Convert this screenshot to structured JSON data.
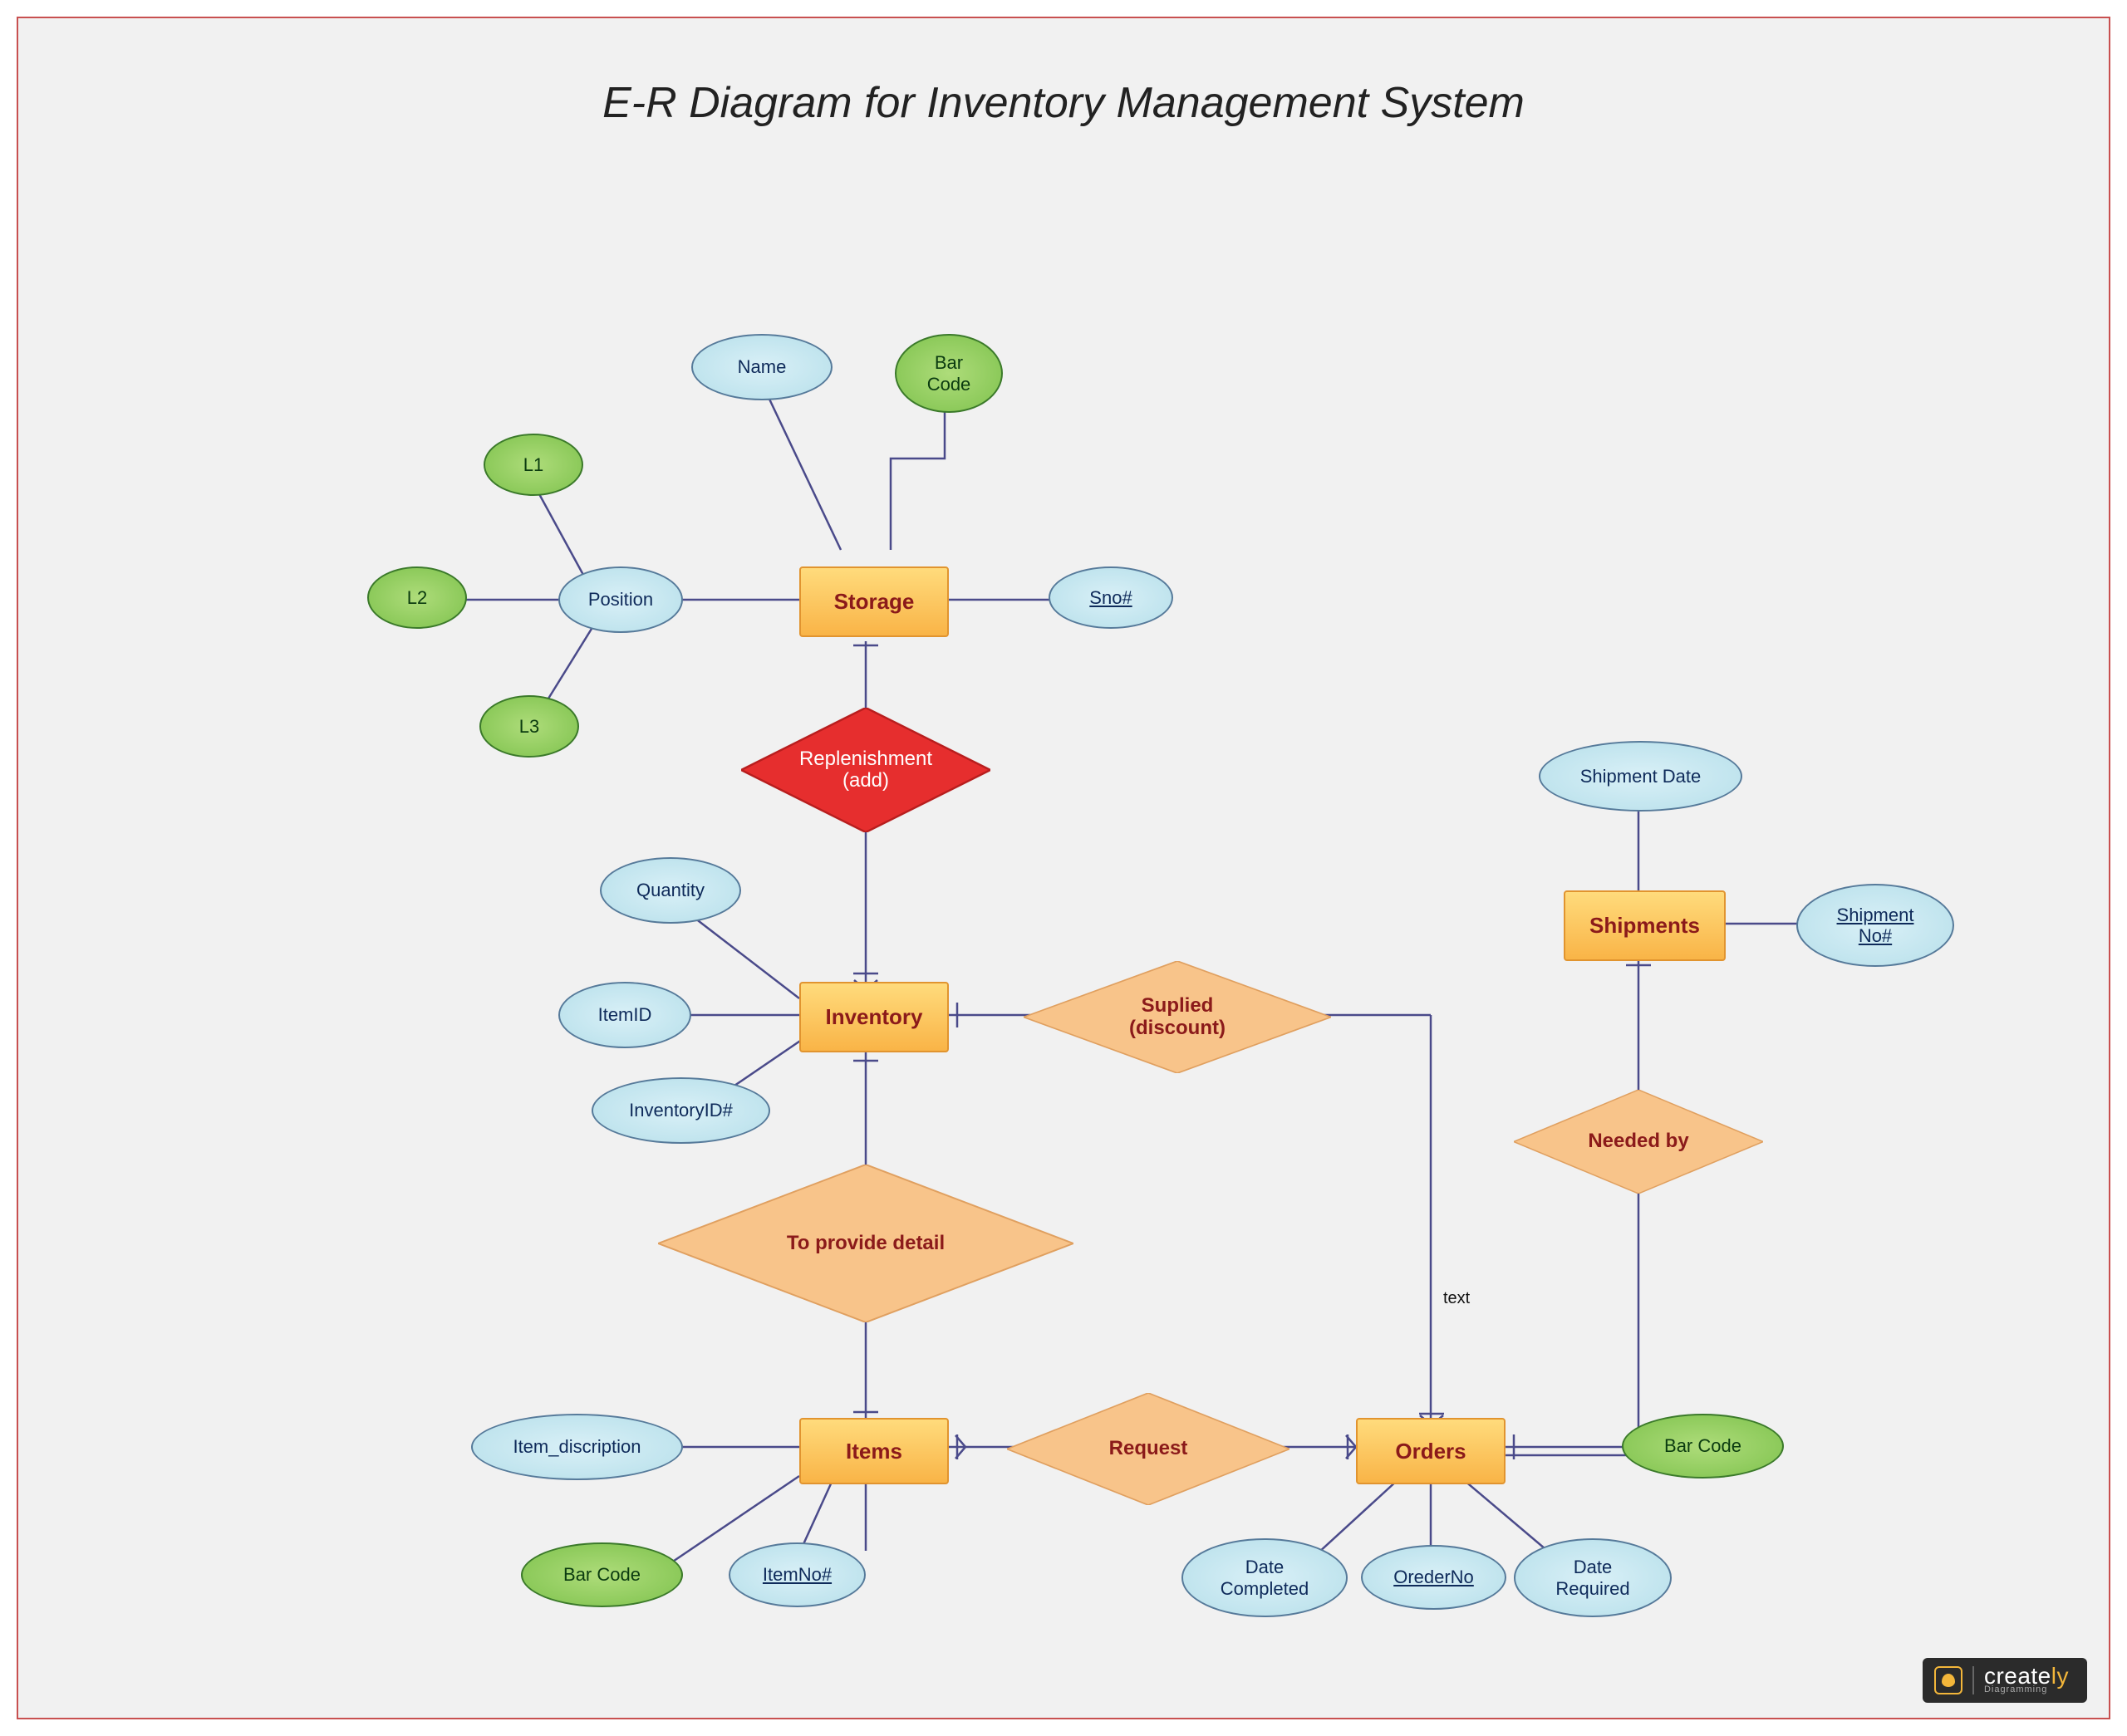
{
  "title": "E-R Diagram for Inventory Management System",
  "entities": {
    "storage": "Storage",
    "inventory": "Inventory",
    "shipments": "Shipments",
    "items": "Items",
    "orders": "Orders"
  },
  "relationships": {
    "replenishment": "Replenishment\n(add)",
    "supplied": "Suplied\n(discount)",
    "to_provide_detail": "To provide detail",
    "needed_by": "Needed by",
    "request": "Request"
  },
  "attributes": {
    "name": "Name",
    "bar_code_storage": "Bar\nCode",
    "l1": "L1",
    "l2": "L2",
    "l3": "L3",
    "position": "Position",
    "sno": "Sno#",
    "shipment_date": "Shipment Date",
    "shipment_no": "Shipment\nNo#",
    "quantity": "Quantity",
    "item_id": "ItemID",
    "inventory_id": "InventoryID#",
    "item_description": "Item_discription",
    "item_no": "ItemNo#",
    "bar_code_items": "Bar Code",
    "bar_code_orders": "Bar Code",
    "date_completed": "Date\nCompleted",
    "order_no": "OrederNo",
    "date_required": "Date\nRequired"
  },
  "labels": {
    "text": "text"
  },
  "brand": {
    "name_a": "create",
    "name_b": "ly",
    "sub": "Diagramming"
  }
}
